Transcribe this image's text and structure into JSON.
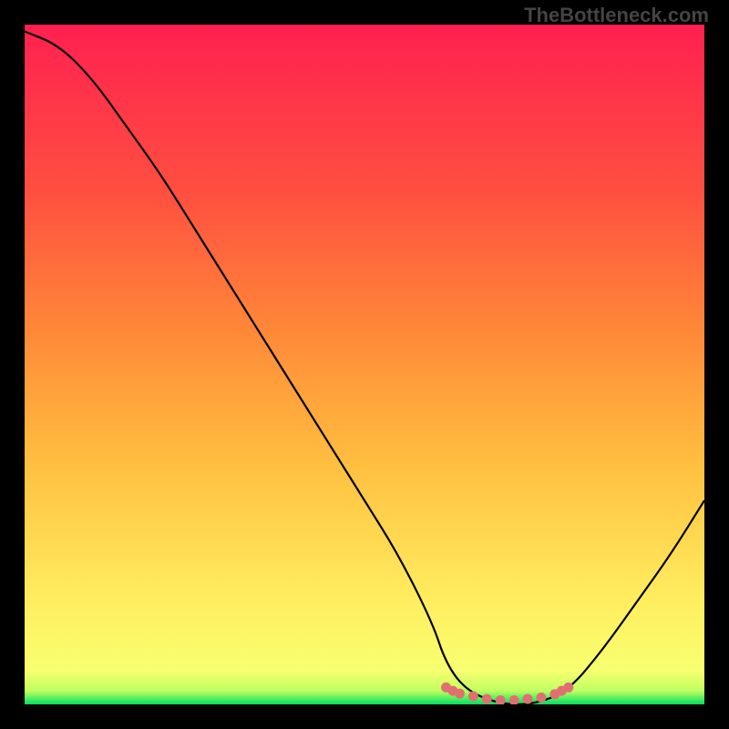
{
  "watermark": "TheBottleneck.com",
  "chart_data": {
    "type": "line",
    "title": "",
    "xlabel": "",
    "ylabel": "",
    "x_range": [
      0,
      100
    ],
    "y_range": [
      0,
      100
    ],
    "gradient_stops": [
      {
        "pos": 0,
        "color": "#00e060"
      },
      {
        "pos": 2,
        "color": "#c0ff60"
      },
      {
        "pos": 5,
        "color": "#f8ff70"
      },
      {
        "pos": 15,
        "color": "#ffee60"
      },
      {
        "pos": 35,
        "color": "#ffc040"
      },
      {
        "pos": 55,
        "color": "#ff8838"
      },
      {
        "pos": 75,
        "color": "#ff5040"
      },
      {
        "pos": 100,
        "color": "#ff2050"
      }
    ],
    "series": [
      {
        "name": "bottleneck-curve",
        "color": "#000000",
        "x": [
          0,
          5,
          10,
          15,
          20,
          25,
          30,
          35,
          40,
          45,
          50,
          55,
          60,
          62,
          65,
          70,
          75,
          80,
          85,
          90,
          95,
          100
        ],
        "y": [
          99,
          97,
          92,
          85,
          78,
          70,
          62,
          54,
          46,
          38,
          30,
          22,
          12,
          6,
          2,
          0,
          0,
          2,
          8,
          15,
          22,
          30
        ]
      }
    ],
    "markers": {
      "name": "highlight-dots",
      "color": "#e07070",
      "x": [
        62,
        63,
        64,
        66,
        68,
        70,
        72,
        74,
        76,
        78,
        79,
        80
      ],
      "y": [
        2.5,
        2.0,
        1.6,
        1.2,
        0.8,
        0.6,
        0.6,
        0.8,
        1.0,
        1.5,
        2.0,
        2.5
      ]
    }
  }
}
